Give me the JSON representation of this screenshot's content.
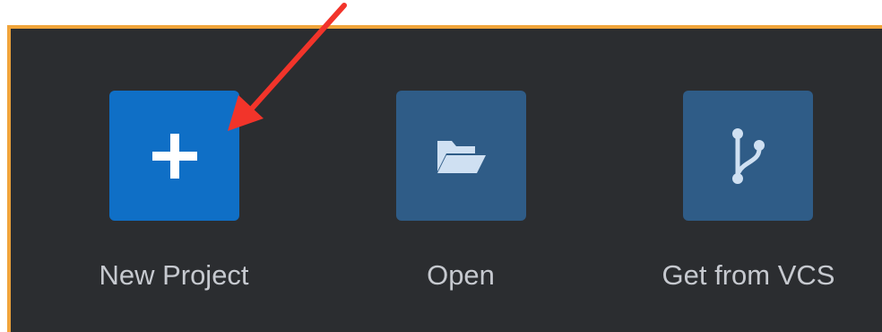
{
  "actions": [
    {
      "id": "new",
      "label": "New Project",
      "icon": "plus-icon",
      "color": "#0f6fc6"
    },
    {
      "id": "open",
      "label": "Open",
      "icon": "folder-open-icon",
      "color": "#2f5c87"
    },
    {
      "id": "vcs",
      "label": "Get from VCS",
      "icon": "branch-icon",
      "color": "#2f5c87"
    }
  ],
  "accent": {
    "border": "#f0a43a",
    "annotation_arrow": "#f2342a"
  }
}
